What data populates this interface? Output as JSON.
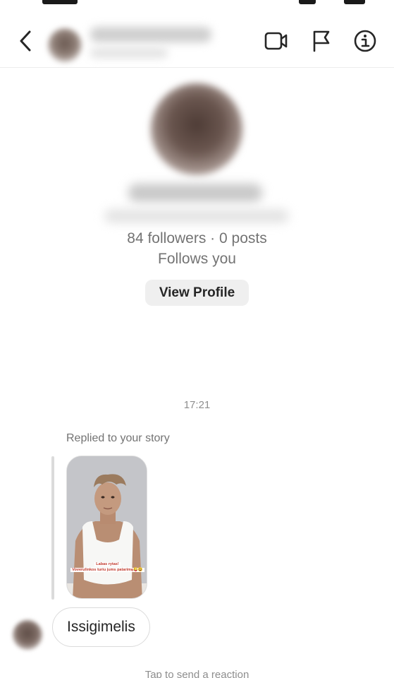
{
  "icons": {
    "back": "chevron-left-icon",
    "video": "video-camera-icon",
    "report": "flag-icon",
    "info": "info-icon"
  },
  "profile": {
    "stats": "84 followers · 0 posts",
    "follows": "Follows you",
    "view_profile_label": "View Profile"
  },
  "thread": {
    "timestamp": "17:21",
    "replied_label": "Replied to your story",
    "story_caption_line1": "Labas rytas!",
    "story_caption_line2": "Voverulinkos turiu jums patarimą😜😆",
    "message": "Issigimelis",
    "reaction_hint": "Tap to send a reaction"
  },
  "colors": {
    "text_primary": "#262626",
    "text_secondary": "#737373",
    "button_bg": "#efefef",
    "bubble_border": "#dbdbdb"
  }
}
